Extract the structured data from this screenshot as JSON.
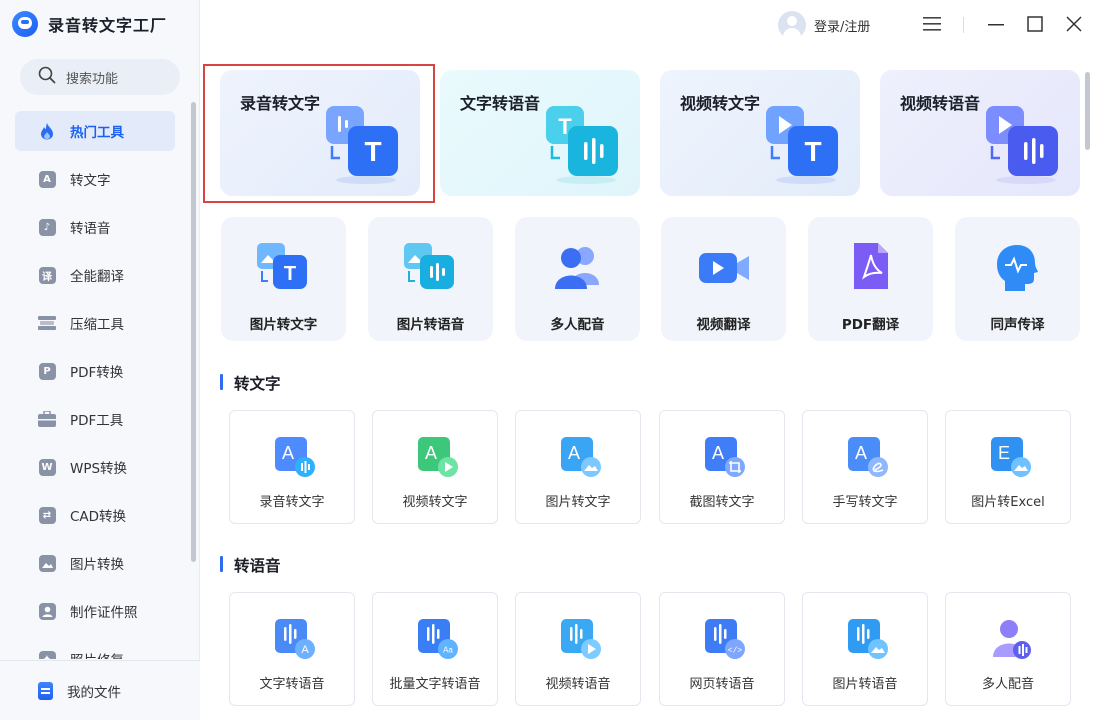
{
  "app": {
    "title": "录音转文字工厂"
  },
  "search": {
    "label": "搜索功能"
  },
  "sidebar": {
    "items": [
      {
        "label": "热门工具",
        "icon": "flame-icon"
      },
      {
        "label": "转文字",
        "icon": "text-convert-icon"
      },
      {
        "label": "转语音",
        "icon": "speech-icon"
      },
      {
        "label": "全能翻译",
        "icon": "translate-icon"
      },
      {
        "label": "压缩工具",
        "icon": "compress-icon"
      },
      {
        "label": "PDF转换",
        "icon": "pdf-convert-icon"
      },
      {
        "label": "PDF工具",
        "icon": "toolbox-icon"
      },
      {
        "label": "WPS转换",
        "icon": "wps-icon"
      },
      {
        "label": "CAD转换",
        "icon": "cad-icon"
      },
      {
        "label": "图片转换",
        "icon": "image-icon"
      },
      {
        "label": "制作证件照",
        "icon": "id-photo-icon"
      },
      {
        "label": "照片修复",
        "icon": "photo-repair-icon"
      }
    ],
    "bottom": {
      "label": "我的文件"
    }
  },
  "header": {
    "login_label": "登录/注册"
  },
  "hot_tools": [
    {
      "label": "录音转文字"
    },
    {
      "label": "文字转语音"
    },
    {
      "label": "视频转文字"
    },
    {
      "label": "视频转语音"
    }
  ],
  "quick_tools": [
    {
      "label": "图片转文字"
    },
    {
      "label": "图片转语音"
    },
    {
      "label": "多人配音"
    },
    {
      "label": "视频翻译"
    },
    {
      "label": "PDF翻译"
    },
    {
      "label": "同声传译"
    }
  ],
  "sections": [
    {
      "title": "转文字",
      "tools": [
        {
          "label": "录音转文字",
          "icon_letter": "A",
          "badge": "audio"
        },
        {
          "label": "视频转文字",
          "icon_letter": "A",
          "badge": "video"
        },
        {
          "label": "图片转文字",
          "icon_letter": "A",
          "badge": "image"
        },
        {
          "label": "截图转文字",
          "icon_letter": "A",
          "badge": "crop"
        },
        {
          "label": "手写转文字",
          "icon_letter": "A",
          "badge": "handwriting"
        },
        {
          "label": "图片转Excel",
          "icon_letter": "E",
          "badge": "image"
        }
      ]
    },
    {
      "title": "转语音",
      "tools": [
        {
          "label": "文字转语音",
          "icon_letter": "A",
          "badge": "text"
        },
        {
          "label": "批量文字转语音",
          "icon_letter": "Aa",
          "badge": "batch"
        },
        {
          "label": "视频转语音",
          "icon_letter": "",
          "badge": "video"
        },
        {
          "label": "网页转语音",
          "icon_letter": "</>",
          "badge": "web"
        },
        {
          "label": "图片转语音",
          "icon_letter": "",
          "badge": "image"
        },
        {
          "label": "多人配音",
          "icon_letter": "",
          "badge": "people"
        }
      ]
    }
  ],
  "colors": {
    "accent": "#1c62f0",
    "highlight_border": "#d84343"
  }
}
